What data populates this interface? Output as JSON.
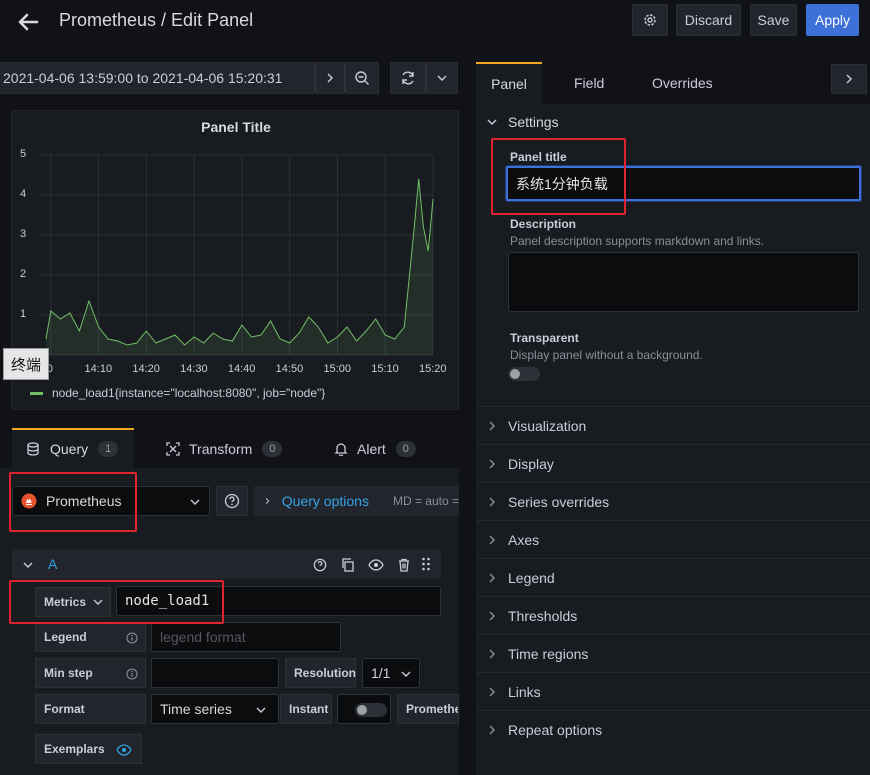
{
  "header": {
    "title": "Prometheus / Edit Panel",
    "discard_label": "Discard",
    "save_label": "Save",
    "apply_label": "Apply"
  },
  "time_range": {
    "label": "2021-04-06 13:59:00 to 2021-04-06 15:20:31"
  },
  "panel": {
    "title": "Panel Title",
    "legend": "node_load1{instance=\"localhost:8080\", job=\"node\"}",
    "tooltip": "终端"
  },
  "chart_data": {
    "type": "area",
    "title": "Panel Title",
    "x": [
      "13:59",
      "14:00",
      "14:02",
      "14:04",
      "14:06",
      "14:08",
      "14:10",
      "14:12",
      "14:14",
      "14:16",
      "14:18",
      "14:20",
      "14:22",
      "14:24",
      "14:26",
      "14:28",
      "14:30",
      "14:32",
      "14:34",
      "14:36",
      "14:38",
      "14:40",
      "14:42",
      "14:44",
      "14:46",
      "14:48",
      "14:50",
      "14:52",
      "14:54",
      "14:56",
      "14:58",
      "15:00",
      "15:02",
      "15:04",
      "15:06",
      "15:08",
      "15:10",
      "15:12",
      "15:14",
      "15:15",
      "15:16",
      "15:17",
      "15:18",
      "15:19",
      "15:20"
    ],
    "series": [
      {
        "name": "node_load1{instance=\"localhost:8080\", job=\"node\"}",
        "values": [
          0.4,
          1.1,
          0.9,
          1.05,
          0.6,
          1.35,
          0.7,
          0.4,
          0.35,
          0.25,
          0.3,
          0.6,
          0.3,
          0.4,
          0.5,
          0.25,
          0.45,
          0.3,
          0.55,
          0.4,
          0.35,
          0.75,
          0.45,
          0.5,
          0.85,
          0.4,
          0.3,
          0.55,
          0.95,
          0.7,
          0.3,
          0.45,
          0.7,
          0.35,
          0.6,
          0.9,
          0.5,
          0.4,
          0.7,
          1.9,
          3.1,
          4.4,
          3.2,
          2.6,
          3.9
        ]
      }
    ],
    "x_ticks": [
      "0",
      "14:10",
      "14:20",
      "14:30",
      "14:40",
      "14:50",
      "15:00",
      "15:10",
      "15:20"
    ],
    "y_ticks": [
      "5",
      "4",
      "3",
      "2",
      "1"
    ],
    "ylim": [
      0,
      5
    ],
    "grid": true,
    "color": "#73bf69"
  },
  "query_tabs": [
    {
      "label": "Query",
      "count": "1"
    },
    {
      "label": "Transform",
      "count": "0"
    },
    {
      "label": "Alert",
      "count": "0"
    }
  ],
  "datasource": {
    "name": "Prometheus",
    "query_options": "Query options",
    "md_text": "MD = auto ="
  },
  "query": {
    "ref": "A",
    "metrics_label": "Metrics",
    "metrics_value": "node_load1",
    "legend_label": "Legend",
    "legend_placeholder": "legend format",
    "min_step_label": "Min step",
    "resolution_label": "Resolution",
    "resolution_value": "1/1",
    "format_label": "Format",
    "format_value": "Time series",
    "instant_label": "Instant",
    "prometheus_label": "Promethe",
    "exemplars_label": "Exemplars"
  },
  "right_tabs": [
    {
      "label": "Panel"
    },
    {
      "label": "Field"
    },
    {
      "label": "Overrides"
    }
  ],
  "settings": {
    "heading": "Settings",
    "panel_title_label": "Panel title",
    "panel_title_value": "系统1分钟负载",
    "description_label": "Description",
    "description_hint": "Panel description supports markdown and links.",
    "transparent_label": "Transparent",
    "transparent_hint": "Display panel without a background."
  },
  "sections": [
    "Visualization",
    "Display",
    "Series overrides",
    "Axes",
    "Legend",
    "Thresholds",
    "Time regions",
    "Links",
    "Repeat options"
  ],
  "colors": {
    "accent": "#3d71d9",
    "brand": "#f5a623",
    "highlight": "#e0242f",
    "link": "#33a2e5"
  }
}
